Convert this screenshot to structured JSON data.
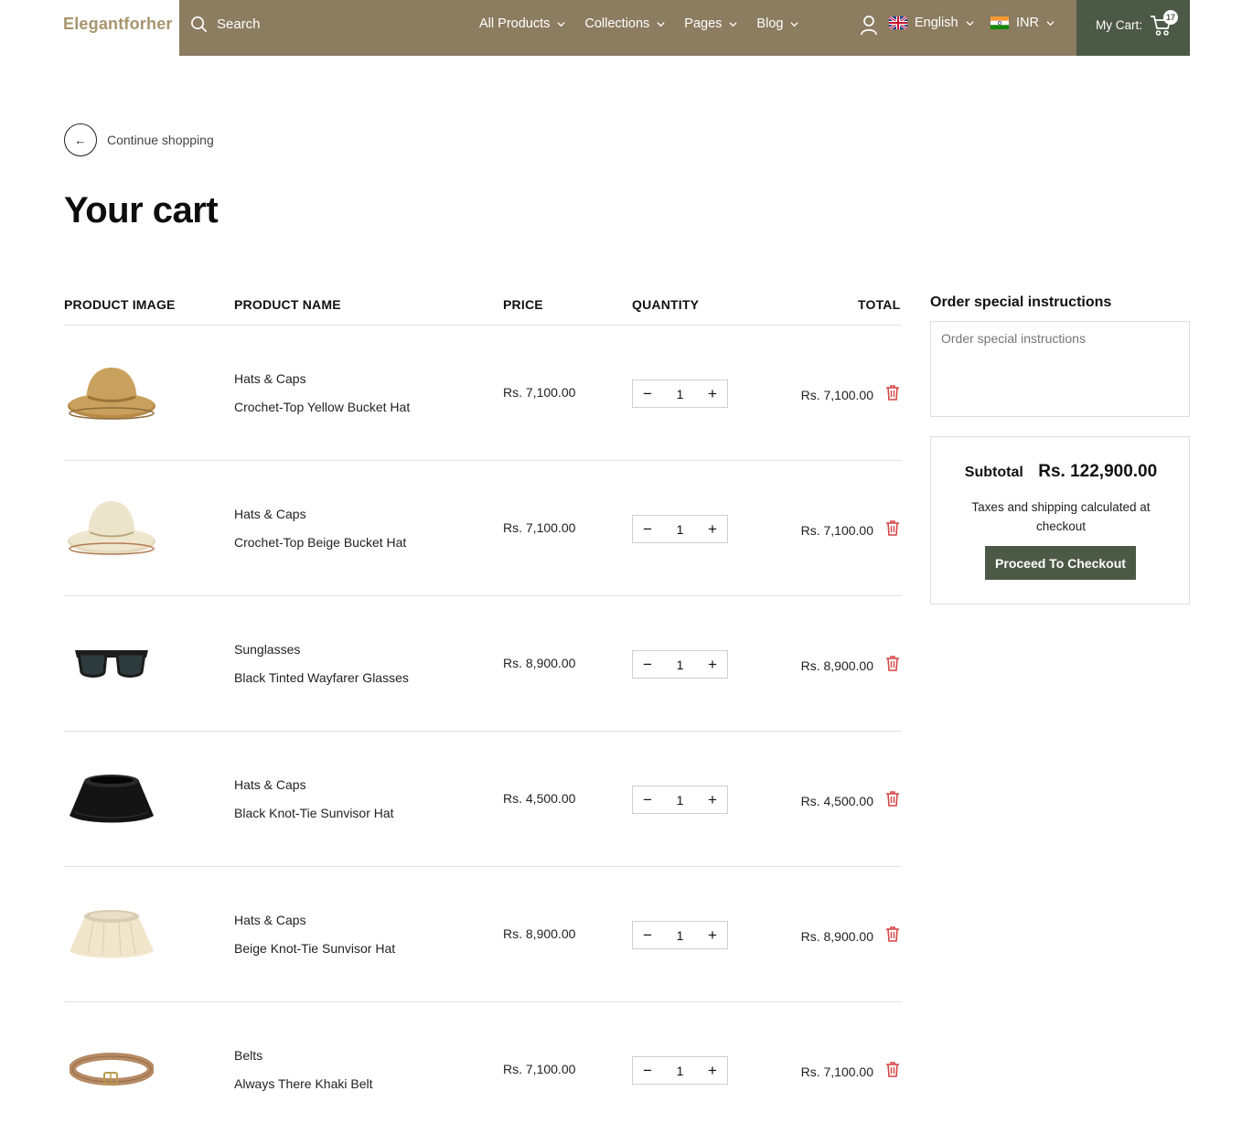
{
  "header": {
    "logo": "Elegantforher",
    "search_label": "Search",
    "nav": [
      "All Products",
      "Collections",
      "Pages",
      "Blog"
    ],
    "language": "English",
    "currency": "INR",
    "cart_label": "My Cart:",
    "cart_count": "17"
  },
  "continue_label": "Continue shopping",
  "title": "Your cart",
  "table_headers": {
    "image": "PRODUCT IMAGE",
    "name": "PRODUCT NAME",
    "price": "PRICE",
    "quantity": "QUANTITY",
    "total": "TOTAL"
  },
  "items": [
    {
      "category": "Hats & Caps",
      "name": "Crochet-Top Yellow Bucket Hat",
      "price": "Rs. 7,100.00",
      "qty": "1",
      "total": "Rs. 7,100.00",
      "image": "yellow-bucket-hat",
      "color": "#c9a15e"
    },
    {
      "category": "Hats & Caps",
      "name": "Crochet-Top Beige Bucket Hat",
      "price": "Rs. 7,100.00",
      "qty": "1",
      "total": "Rs. 7,100.00",
      "image": "beige-bucket-hat",
      "color": "#efe6cf"
    },
    {
      "category": "Sunglasses",
      "name": "Black Tinted Wayfarer Glasses",
      "price": "Rs. 8,900.00",
      "qty": "1",
      "total": "Rs. 8,900.00",
      "image": "sunglasses",
      "color": "#1c1c1c"
    },
    {
      "category": "Hats & Caps",
      "name": "Black Knot-Tie Sunvisor Hat",
      "price": "Rs. 4,500.00",
      "qty": "1",
      "total": "Rs. 4,500.00",
      "image": "black-sunvisor",
      "color": "#141414"
    },
    {
      "category": "Hats & Caps",
      "name": "Beige Knot-Tie Sunvisor Hat",
      "price": "Rs. 8,900.00",
      "qty": "1",
      "total": "Rs. 8,900.00",
      "image": "beige-sunvisor",
      "color": "#f1e6cc"
    },
    {
      "category": "Belts",
      "name": "Always There Khaki Belt",
      "price": "Rs. 7,100.00",
      "qty": "1",
      "total": "Rs. 7,100.00",
      "image": "khaki-belt",
      "color": "#b68a64"
    }
  ],
  "sidebar": {
    "instructions_heading": "Order special instructions",
    "instructions_placeholder": "Order special instructions",
    "subtotal_label": "Subtotal",
    "subtotal_value": "Rs. 122,900.00",
    "tax_note": "Taxes and shipping calculated at checkout",
    "checkout_label": "Proceed To Checkout"
  },
  "colors": {
    "nav_bg": "#8c7c60",
    "cart_bg": "#4d5947",
    "logo": "#a8956e",
    "delete": "#d64545"
  }
}
